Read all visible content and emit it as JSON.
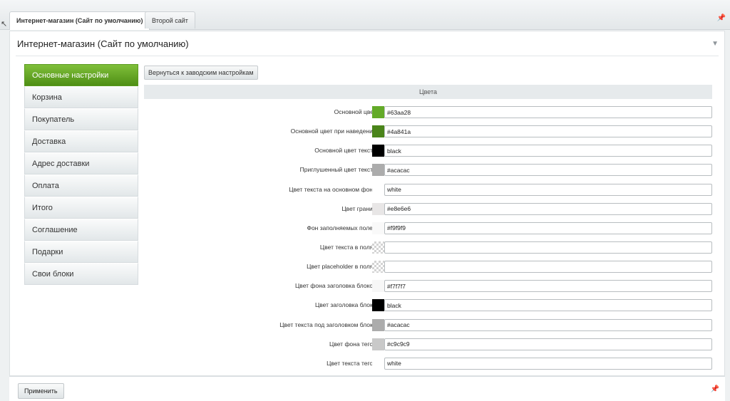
{
  "tabs": [
    {
      "label": "Интернет-магазин (Сайт по умолчанию)",
      "active": true
    },
    {
      "label": "Второй сайт",
      "active": false
    }
  ],
  "icons": {
    "pin": "pin-icon",
    "collapse": "chevron-down-icon",
    "cursor": "mouse-cursor-icon"
  },
  "panel": {
    "title": "Интернет-магазин (Сайт по умолчанию)"
  },
  "sidebar": {
    "items": [
      {
        "label": "Основные настройки",
        "active": true
      },
      {
        "label": "Корзина"
      },
      {
        "label": "Покупатель"
      },
      {
        "label": "Доставка"
      },
      {
        "label": "Адрес доставки"
      },
      {
        "label": "Оплата"
      },
      {
        "label": "Итого"
      },
      {
        "label": "Соглашение"
      },
      {
        "label": "Подарки"
      },
      {
        "label": "Свои блоки"
      }
    ]
  },
  "reset_button": "Вернуться к заводским настройкам",
  "section_title": "Цвета",
  "colors": [
    {
      "label": "Основной цвет:",
      "value": "#63aa28",
      "swatch": "#63aa28"
    },
    {
      "label": "Основной цвет при наведении:",
      "value": "#4a841a",
      "swatch": "#4a841a"
    },
    {
      "label": "Основной цвет текста:",
      "value": "black",
      "swatch": "#000000"
    },
    {
      "label": "Приглушенный цвет текста:",
      "value": "#acacac",
      "swatch": "#acacac"
    },
    {
      "label": "Цвет текста на основном фоне:",
      "value": "white",
      "swatch": "#ffffff"
    },
    {
      "label": "Цвет границ:",
      "value": "#e8e6e6",
      "swatch": "#e8e6e6"
    },
    {
      "label": "Фон заполняемых полей:",
      "value": "#f9f9f9",
      "swatch": "#f9f9f9"
    },
    {
      "label": "Цвет текста в полях:",
      "value": "",
      "swatch": "transparent"
    },
    {
      "label": "Цвет placeholder в полях:",
      "value": "",
      "swatch": "transparent"
    },
    {
      "label": "Цвет фона заголовка блоков:",
      "value": "#f7f7f7",
      "swatch": "#f7f7f7"
    },
    {
      "label": "Цвет заголовка блока:",
      "value": "black",
      "swatch": "#000000"
    },
    {
      "label": "Цвет текста под заголовком блока:",
      "value": "#acacac",
      "swatch": "#acacac"
    },
    {
      "label": "Цвет фона тегов:",
      "value": "#c9c9c9",
      "swatch": "#c9c9c9"
    },
    {
      "label": "Цвет текста тегов:",
      "value": "white",
      "swatch": "#ffffff"
    }
  ],
  "footer": {
    "apply": "Применить"
  }
}
